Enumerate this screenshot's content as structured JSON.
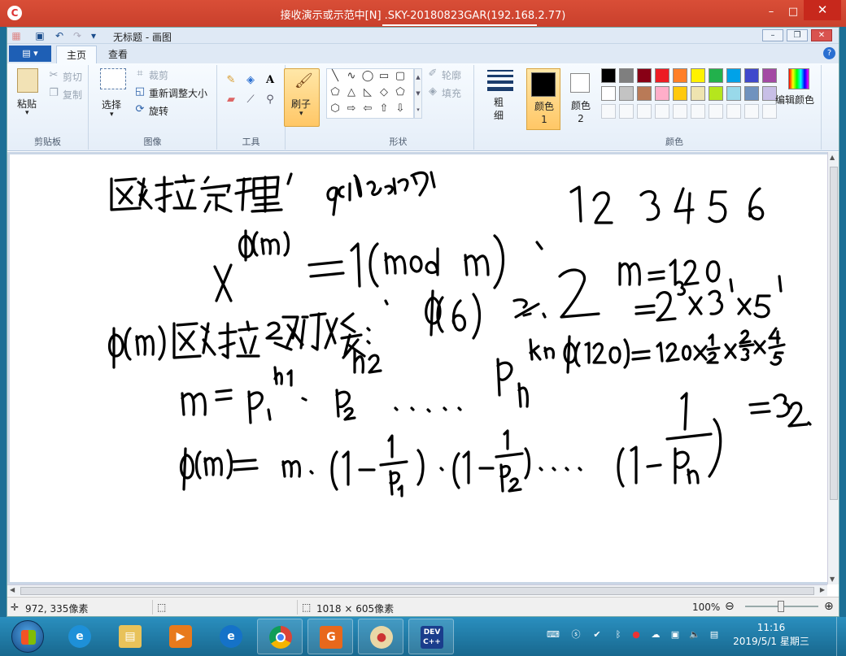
{
  "window": {
    "title": "接收演示或示范中[N] .SKY-20180823GAR(192.168.2.77)",
    "minimize": "–",
    "maximize": "□",
    "close": "✕"
  },
  "paint": {
    "document_title": "无标题 - 画图",
    "tabs": [
      "主页",
      "查看"
    ],
    "groups": {
      "clipboard": {
        "label": "剪贴板",
        "paste": "粘贴",
        "cut": "剪切",
        "copy": "复制"
      },
      "image": {
        "label": "图像",
        "select": "选择",
        "crop": "裁剪",
        "resize": "重新调整大小",
        "rotate": "旋转"
      },
      "tools": {
        "label": "工具"
      },
      "brushes": {
        "label": "刷子"
      },
      "shapes": {
        "label": "形状",
        "outline": "轮廓",
        "fill": "填充"
      },
      "size": {
        "label": "粗细"
      },
      "color1": {
        "label": "颜色 1"
      },
      "color2": {
        "label": "颜色 2"
      },
      "colors": {
        "label": "颜色",
        "edit": "编辑颜色"
      }
    },
    "palette_row1": [
      "#000000",
      "#7f7f7f",
      "#880015",
      "#ed1c24",
      "#ff7f27",
      "#fff200",
      "#22b14c",
      "#00a2e8",
      "#3f48cc",
      "#a349a4"
    ],
    "palette_row2": [
      "#ffffff",
      "#c3c3c3",
      "#b97a57",
      "#ffaec9",
      "#ffc90e",
      "#efe4b0",
      "#b5e61d",
      "#99d9ea",
      "#7092be",
      "#c8bfe7"
    ],
    "status": {
      "cursor_pos": "972, 335像素",
      "canvas_size": "1018 × 605像素",
      "zoom": "100%"
    }
  },
  "taskbar": {
    "time": "11:16",
    "date": "2019/5/1 星期三"
  }
}
